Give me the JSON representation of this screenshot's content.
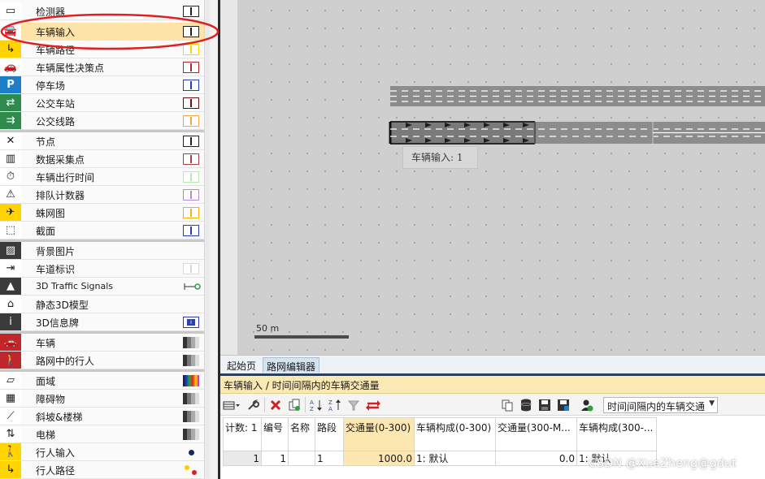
{
  "sidebar": {
    "items": [
      {
        "label": "检测器",
        "icon": "detector-icon",
        "swatch": "#ffffff"
      },
      {
        "label": "车辆输入",
        "icon": "vehicle-input-icon",
        "swatch": "#ffffff",
        "selected": true
      },
      {
        "label": "车辆路径",
        "icon": "vehicle-route-icon",
        "swatch": "#ffd400"
      },
      {
        "label": "车辆属性决策点",
        "icon": "vehicle-attribute-decision-icon",
        "swatch": "#b0262c"
      },
      {
        "label": "停车场",
        "icon": "parking-icon",
        "swatch": "#2a3fb4"
      },
      {
        "label": "公交车站",
        "icon": "bus-stop-icon",
        "swatch": "#6b0f12"
      },
      {
        "label": "公交线路",
        "icon": "bus-line-icon",
        "swatch": "#f4a64a"
      },
      {
        "label": "节点",
        "icon": "node-icon",
        "swatch": "#ffffff"
      },
      {
        "label": "数据采集点",
        "icon": "data-collection-icon",
        "swatch": "#a54242"
      },
      {
        "label": "车辆出行时间",
        "icon": "travel-time-icon",
        "swatch": "#b7e7b7"
      },
      {
        "label": "排队计数器",
        "icon": "queue-counter-icon",
        "swatch": "#b58ad6"
      },
      {
        "label": "蛛网图",
        "icon": "spider-icon",
        "swatch": "#f2b400"
      },
      {
        "label": "截面",
        "icon": "section-icon",
        "swatch": "#2a3fb4"
      },
      {
        "label": "背景图片",
        "icon": "background-image-icon",
        "swatch": ""
      },
      {
        "label": "车道标识",
        "icon": "lane-marking-icon",
        "swatch": "#d9d9d9"
      },
      {
        "label": "3D Traffic Signals",
        "icon": "traffic-signal-icon",
        "swatch": "signal"
      },
      {
        "label": "静态3D模型",
        "icon": "static-3d-model-icon",
        "swatch": ""
      },
      {
        "label": "3D信息牌",
        "icon": "info-sign-icon",
        "swatch": "info"
      },
      {
        "label": "车辆",
        "icon": "vehicle-icon",
        "swatch": "gradient"
      },
      {
        "label": "路网中的行人",
        "icon": "pedestrian-icon",
        "swatch": "gradient"
      },
      {
        "label": "面域",
        "icon": "area-icon",
        "swatch": "rainbow"
      },
      {
        "label": "障碍物",
        "icon": "obstacle-icon",
        "swatch": "gradient"
      },
      {
        "label": "斜坡&楼梯",
        "icon": "ramp-stairs-icon",
        "swatch": "gradient"
      },
      {
        "label": "电梯",
        "icon": "elevator-icon",
        "swatch": "gradient"
      },
      {
        "label": "行人输入",
        "icon": "pedestrian-input-icon",
        "swatch": "dot"
      },
      {
        "label": "行人路径",
        "icon": "pedestrian-route-icon",
        "swatch": "dots"
      }
    ]
  },
  "canvas": {
    "vehicle_input_label": "车辆输入: 1",
    "scale_label": "50 m"
  },
  "tabs": [
    "起始页",
    "路网编辑器"
  ],
  "panel": {
    "title": "车辆输入 / 时间间隔内的车辆交通量",
    "combo_value": "时间间隔内的车辆交通",
    "columns": [
      "计数: 1",
      "编号",
      "名称",
      "路段",
      "交通量(0-300)",
      "车辆构成(0-300)",
      "交通量(300-M...",
      "车辆构成(300-..."
    ],
    "rows": [
      [
        "1",
        "1",
        "",
        "1",
        "1000.0",
        "1: 默认",
        "0.0",
        "1: 默认"
      ]
    ]
  },
  "watermark": "CSDN @XueZheng@gdut"
}
